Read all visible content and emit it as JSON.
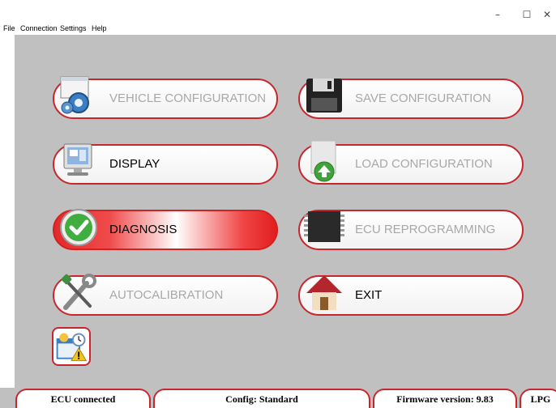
{
  "window": {
    "controls": {
      "minimize": "–",
      "maximize": "☐",
      "close": "✕"
    }
  },
  "menu": [
    "File",
    "Connection",
    "Settings",
    "Help"
  ],
  "buttons": {
    "vehicle_configuration": {
      "label": "VEHICLE CONFIGURATION",
      "enabled": false,
      "icon": "vehicle-config-icon"
    },
    "save_configuration": {
      "label": "SAVE CONFIGURATION",
      "enabled": false,
      "icon": "floppy-disk-icon"
    },
    "display": {
      "label": "DISPLAY",
      "enabled": true,
      "icon": "monitor-icon"
    },
    "load_configuration": {
      "label": "LOAD CONFIGURATION",
      "enabled": false,
      "icon": "load-file-icon"
    },
    "diagnosis": {
      "label": "DIAGNOSIS",
      "enabled": true,
      "selected": true,
      "icon": "green-check-icon"
    },
    "ecu_reprogramming": {
      "label": "ECU REPROGRAMMING",
      "enabled": false,
      "icon": "chip-icon"
    },
    "autocalibration": {
      "label": "AUTOCALIBRATION",
      "enabled": false,
      "icon": "tools-icon"
    },
    "exit": {
      "label": "EXIT",
      "enabled": true,
      "icon": "house-icon"
    }
  },
  "status": {
    "ecu": "ECU connected",
    "config": "Config: Standard",
    "firmware": "Firmware version: 9.83",
    "fuel": "LPG"
  },
  "colors": {
    "accent": "#c8262d",
    "background": "#c0c0c0",
    "disabled_text": "#a8a8a8"
  }
}
